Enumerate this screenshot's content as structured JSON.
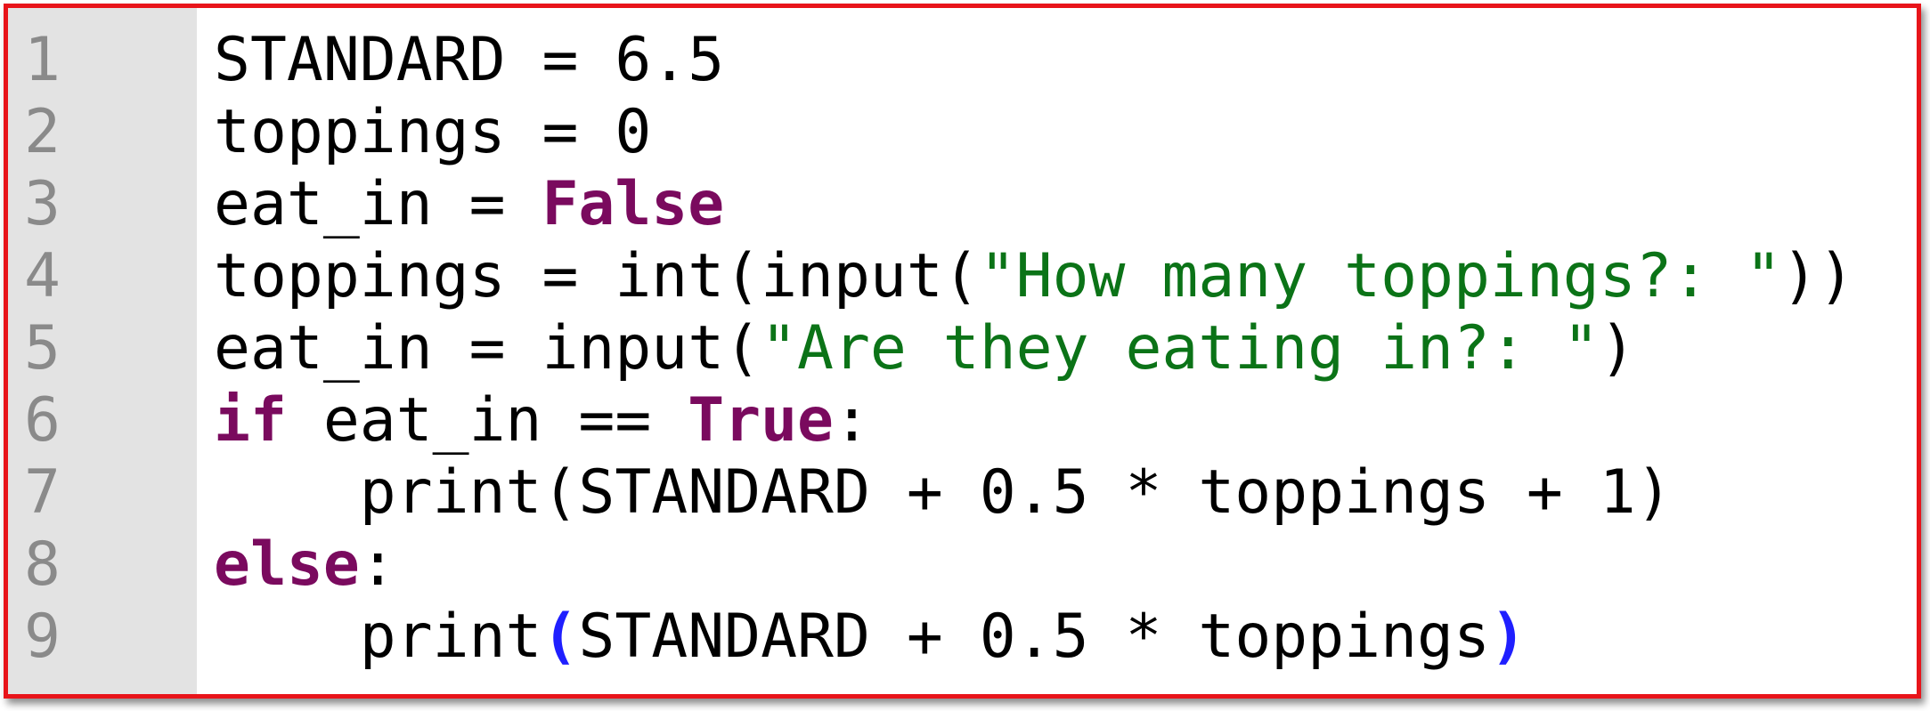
{
  "editor": {
    "lines": [
      {
        "number": "1",
        "tokens": [
          {
            "t": "STANDARD = 6.5",
            "kind": "plain"
          }
        ]
      },
      {
        "number": "2",
        "tokens": [
          {
            "t": "toppings = 0",
            "kind": "plain"
          }
        ]
      },
      {
        "number": "3",
        "tokens": [
          {
            "t": "eat_in = ",
            "kind": "plain"
          },
          {
            "t": "False",
            "kind": "kw"
          }
        ]
      },
      {
        "number": "4",
        "tokens": [
          {
            "t": "toppings = int(input(",
            "kind": "plain"
          },
          {
            "t": "\"How many toppings?: \"",
            "kind": "str"
          },
          {
            "t": "))",
            "kind": "plain"
          }
        ]
      },
      {
        "number": "5",
        "tokens": [
          {
            "t": "eat_in = input(",
            "kind": "plain"
          },
          {
            "t": "\"Are they eating in?: \"",
            "kind": "str"
          },
          {
            "t": ")",
            "kind": "plain"
          }
        ]
      },
      {
        "number": "6",
        "tokens": [
          {
            "t": "if",
            "kind": "kw"
          },
          {
            "t": " eat_in == ",
            "kind": "plain"
          },
          {
            "t": "True",
            "kind": "kw"
          },
          {
            "t": ":",
            "kind": "plain"
          }
        ]
      },
      {
        "number": "7",
        "tokens": [
          {
            "t": "    print(STANDARD + 0.5 * toppings + 1)",
            "kind": "plain"
          }
        ]
      },
      {
        "number": "8",
        "tokens": [
          {
            "t": "else",
            "kind": "kw"
          },
          {
            "t": ":",
            "kind": "plain"
          }
        ]
      },
      {
        "number": "9",
        "tokens": [
          {
            "t": "    print",
            "kind": "plain"
          },
          {
            "t": "(",
            "kind": "br"
          },
          {
            "t": "STANDARD + 0.5 * toppings",
            "kind": "plain"
          },
          {
            "t": ")",
            "kind": "br"
          }
        ]
      }
    ]
  },
  "colors": {
    "frame_border": "#e8141a",
    "gutter_bg": "#e3e3e3",
    "line_number": "#8a8a8a",
    "keyword": "#7a0a5e",
    "string": "#0b7317",
    "matched_bracket": "#1f1fff"
  }
}
